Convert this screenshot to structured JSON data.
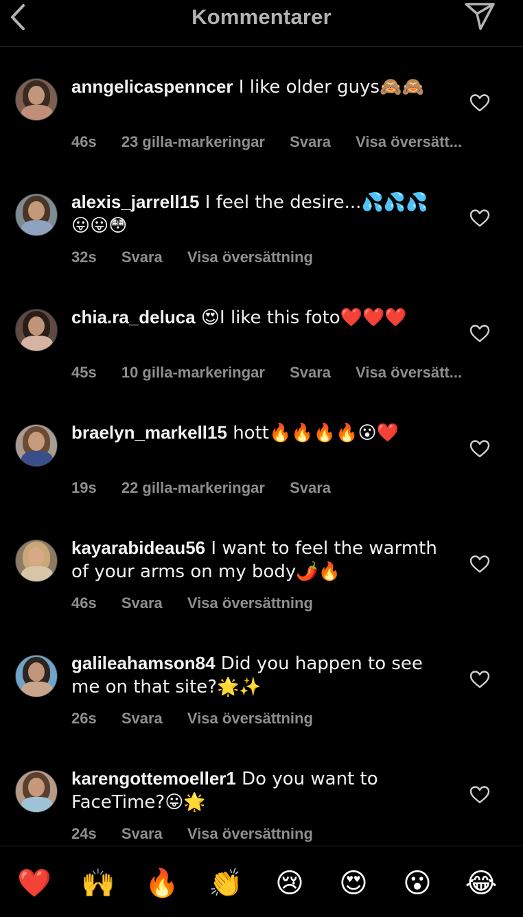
{
  "header": {
    "title": "Kommentarer",
    "back_icon": "chevron-left-icon",
    "send_icon": "paper-plane-icon"
  },
  "comments": [
    {
      "username": "anngelicaspenncer",
      "text": " I like older guys🙈🙈",
      "time": "46s",
      "likes": "23 gilla-markeringar",
      "reply": "Svara",
      "translate": "Visa översätt..."
    },
    {
      "username": "alexis_jarrell15",
      "text": " I feel the desire...💦💦💦😛😛😳",
      "time": "32s",
      "reply": "Svara",
      "translate": "Visa översättning"
    },
    {
      "username": "chia.ra_deluca",
      "text": " 😍I like this foto❤️❤️❤️",
      "time": "45s",
      "likes": "10 gilla-markeringar",
      "reply": "Svara",
      "translate": "Visa översätt..."
    },
    {
      "username": "braelyn_markell15",
      "text": " hott🔥🔥🔥🔥😮❤️",
      "time": "19s",
      "likes": "22 gilla-markeringar",
      "reply": "Svara"
    },
    {
      "username": "kayarabideau56",
      "text": " I want to feel the warmth of your arms on my body🌶️🔥",
      "time": "46s",
      "reply": "Svara",
      "translate": "Visa översättning"
    },
    {
      "username": "galileahamson84",
      "text": " Did you happen to see me on that site?🌟✨",
      "time": "26s",
      "reply": "Svara",
      "translate": "Visa översättning"
    },
    {
      "username": "karengottemoeller1",
      "text": " Do you want to FaceTime?😛🌟",
      "time": "24s",
      "reply": "Svara",
      "translate": "Visa översättning"
    }
  ],
  "reactions": [
    "❤️",
    "🙌",
    "🔥",
    "👏",
    "😢",
    "😍",
    "😮",
    "😂"
  ],
  "colors": {
    "background": "#000000",
    "title": "#b3b3b3",
    "meta": "#8e8e8e",
    "text": "#f2f2f2"
  }
}
